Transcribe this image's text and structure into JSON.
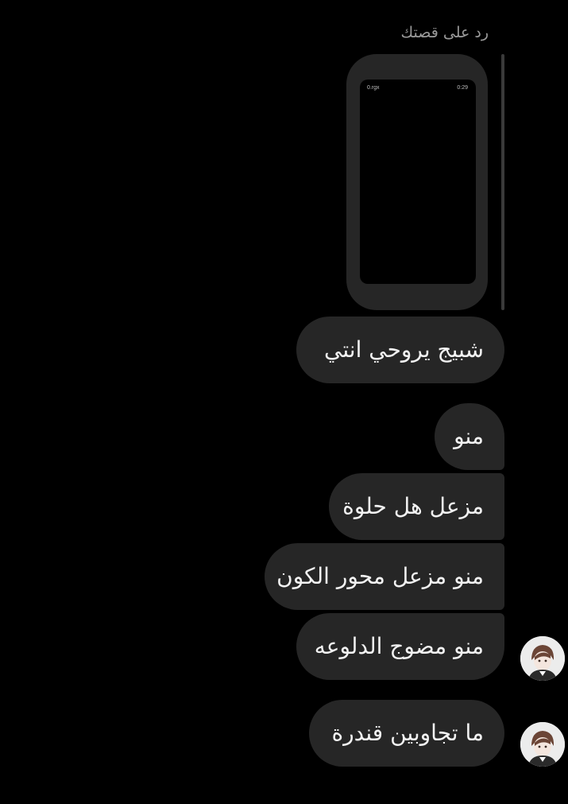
{
  "header": {
    "reply_label": "رد على قصتك"
  },
  "story": {
    "account_name": "0.rgx",
    "duration": "0:29"
  },
  "messages": [
    {
      "text": "شبيج يروحي انتي"
    },
    {
      "text": "منو"
    },
    {
      "text": "مزعل هل حلوة"
    },
    {
      "text": "منو مزعل محور الكون"
    },
    {
      "text": "منو مضوج الدلوعه"
    },
    {
      "text": "ما تجاوبين قندرة"
    }
  ],
  "colors": {
    "background": "#000000",
    "bubble": "#262626",
    "text": "#f2f2f2",
    "muted_text": "#9a9a9a"
  },
  "icons": {
    "avatar": "contact-avatar-icon"
  }
}
